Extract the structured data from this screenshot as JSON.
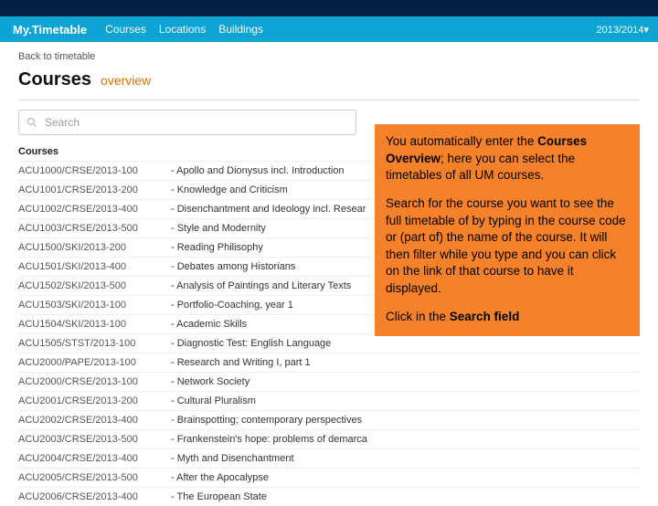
{
  "banner": {},
  "nav": {
    "brand": "My.Timetable",
    "links": [
      "Courses",
      "Locations",
      "Buildings"
    ],
    "year": "2013/2014▾"
  },
  "back": "Back to timetable",
  "page": {
    "title": "Courses",
    "subtitle": "overview"
  },
  "search": {
    "placeholder": "Search"
  },
  "section_label": "Courses",
  "courses": [
    {
      "code": "ACU1000/CRSE/2013-100",
      "title": "Apollo and Dionysus incl. Introduction"
    },
    {
      "code": "ACU1001/CRSE/2013-200",
      "title": "Knowledge and Criticism"
    },
    {
      "code": "ACU1002/CRSE/2013-400",
      "title": "Disenchantment and Ideology incl. Resear"
    },
    {
      "code": "ACU1003/CRSE/2013-500",
      "title": "Style and Modernity"
    },
    {
      "code": "ACU1500/SKI/2013-200",
      "title": "Reading Philisophy"
    },
    {
      "code": "ACU1501/SKI/2013-400",
      "title": "Debates among Historians"
    },
    {
      "code": "ACU1502/SKI/2013-500",
      "title": "Analysis of Paintings and Literary Texts"
    },
    {
      "code": "ACU1503/SKI/2013-100",
      "title": "Portfolio-Coaching, year 1"
    },
    {
      "code": "ACU1504/SKI/2013-100",
      "title": "Academic Skills"
    },
    {
      "code": "ACU1505/STST/2013-100",
      "title": "Diagnostic Test: English Language"
    },
    {
      "code": "ACU2000/PAPE/2013-100",
      "title": "Research and Writing I, part 1"
    },
    {
      "code": "ACU2000/CRSE/2013-100",
      "title": "Network Society"
    },
    {
      "code": "ACU2001/CRSE/2013-200",
      "title": "Cultural Pluralism"
    },
    {
      "code": "ACU2002/CRSE/2013-400",
      "title": "Brainspotting; contemporary perspectives"
    },
    {
      "code": "ACU2003/CRSE/2013-500",
      "title": "Frankenstein's hope: problems of demarca"
    },
    {
      "code": "ACU2004/CRSE/2013-400",
      "title": "Myth and Disenchantment"
    },
    {
      "code": "ACU2005/CRSE/2013-500",
      "title": "After the Apocalypse"
    },
    {
      "code": "ACU2006/CRSE/2013-400",
      "title": "The European State"
    }
  ],
  "callout": {
    "p1a": "You automatically enter the ",
    "p1b": "Courses Overview",
    "p1c": "; here you can select the timetables of all UM courses.",
    "p2": "Search for the course you want to see the full timetable of by typing in the course code or (part of) the name of the course. It will then filter while you type and you can click on the link of that course to have it displayed.",
    "p3a": "Click in the ",
    "p3b": "Search field"
  }
}
